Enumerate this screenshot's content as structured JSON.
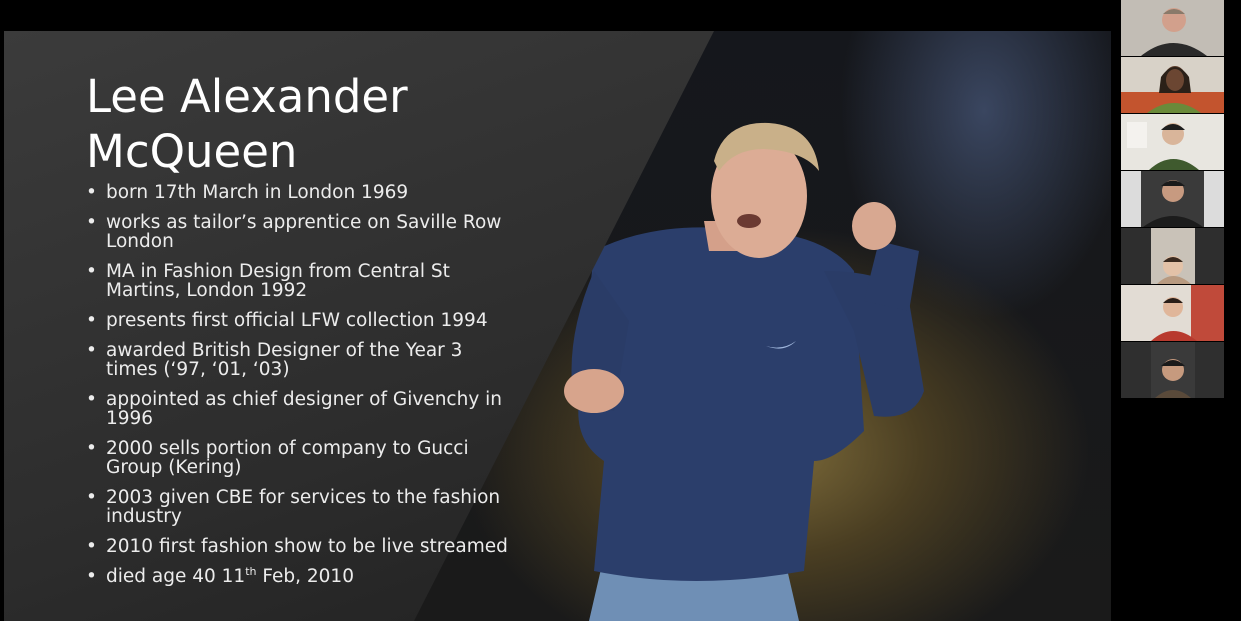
{
  "slide": {
    "title_line1": "Lee Alexander",
    "title_line2": "McQueen",
    "bullets": [
      "born  17th March in London 1969",
      "works as tailor’s apprentice on Saville Row London",
      "MA in Fashion Design from Central St Martins, London 1992",
      "presents first official LFW collection 1994",
      "awarded British Designer of the Year 3 times (‘97, ‘01, ‘03)",
      "appointed as chief designer of Givenchy in 1996",
      "2000 sells portion of company to Gucci Group (Kering)",
      "2003 given CBE for services to the fashion industry",
      "2010 first fashion show to be live streamed"
    ],
    "last_bullet": {
      "pre": "died age 40 11",
      "sup": "th",
      "post": " Feb, 2010"
    }
  },
  "colors": {
    "background": "#000000",
    "slide_panel": "#2f2f2f",
    "text": "#ffffff"
  }
}
